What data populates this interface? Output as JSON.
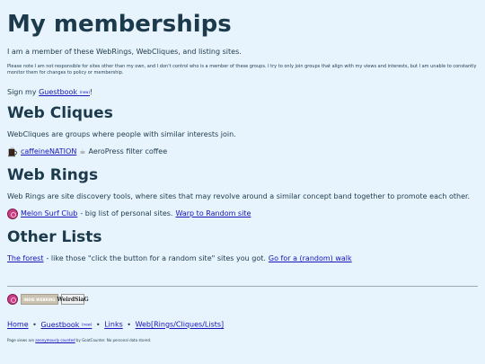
{
  "page": {
    "title": "My memberships",
    "intro": "I am a member of these WebRings, WebCliques, and listing sites.",
    "note": "Please note I am not responsible for sites other than my own, and I don't control who is a member of these groups. I try to only join groups that align with my views and interests, but I am unable to constantly monitor them for changes to policy or membership.",
    "sign": {
      "prefix": "Sign my",
      "link": "Guestbook",
      "new_tag": "(new)",
      "suffix": "!"
    }
  },
  "cliques": {
    "heading": "Web Cliques",
    "description": "WebCliques are groups where people with similar interests join.",
    "items": [
      {
        "icon": "coffee-cup-icon",
        "link": "caffeineNATION",
        "glyph": "☕",
        "text": "AeroPress filter coffee"
      }
    ]
  },
  "rings": {
    "heading": "Web Rings",
    "description": "Web Rings are site discovery tools, where sites that may revolve around a similar concept band together to promote each other.",
    "items": [
      {
        "icon": "melon-ring-icon",
        "link": "Melon Surf Club",
        "text": " - big list of personal sites.",
        "action": "Warp to Random site"
      }
    ]
  },
  "other": {
    "heading": "Other Lists",
    "link": "The forest",
    "text": " - like those \"click the button for a random site\" sites you got.",
    "action": "Go for a (random) walk"
  },
  "footer": {
    "badges": [
      {
        "name": "melon-ring-icon"
      },
      {
        "name": "indie-webring-badge",
        "label": "INDIE WEBRING"
      },
      {
        "name": "weird-badge",
        "label": "WeirdSiaG"
      }
    ],
    "nav": {
      "home": "Home",
      "guestbook": "Guestbook",
      "new_tag": "(new)",
      "links": "Links",
      "web": "Web[Rings/Cliques/Lists]",
      "separator": "•"
    },
    "credit_prefix": "Page views are",
    "credit_link": "anonymously counted",
    "credit_suffix": "by GoatCounter. No personal data stored."
  }
}
